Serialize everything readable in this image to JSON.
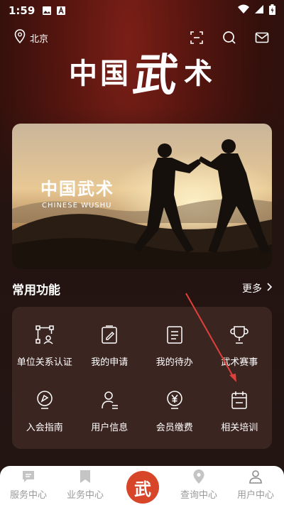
{
  "status": {
    "time": "1:59"
  },
  "topbar": {
    "location": "北京",
    "icons": [
      "scan-icon",
      "search-icon",
      "mail-icon"
    ]
  },
  "logo": {
    "part1": "中国",
    "part2": "武",
    "part3": "术"
  },
  "banner": {
    "title": "中国武术",
    "subtitle": "CHINESE WUSHU"
  },
  "section": {
    "title": "常用功能",
    "more": "更多"
  },
  "functions": [
    {
      "label": "单位关系认证",
      "icon": "certification-icon"
    },
    {
      "label": "我的申请",
      "icon": "edit-document-icon"
    },
    {
      "label": "我的待办",
      "icon": "todo-list-icon"
    },
    {
      "label": "武术赛事",
      "icon": "trophy-icon"
    },
    {
      "label": "入会指南",
      "icon": "guide-icon"
    },
    {
      "label": "用户信息",
      "icon": "user-info-icon"
    },
    {
      "label": "会员缴费",
      "icon": "payment-icon"
    },
    {
      "label": "相关培训",
      "icon": "calendar-icon"
    }
  ],
  "tabs": [
    {
      "label": "服务中心",
      "icon": "chat-icon"
    },
    {
      "label": "业务中心",
      "icon": "bookmark-icon"
    },
    {
      "label": "查询中心",
      "icon": "location-icon"
    },
    {
      "label": "用户中心",
      "icon": "user-icon"
    }
  ],
  "tab_center": {
    "label": "武"
  },
  "colors": {
    "accent": "#d8462a",
    "background": "#241411",
    "card": "#3b2521"
  }
}
